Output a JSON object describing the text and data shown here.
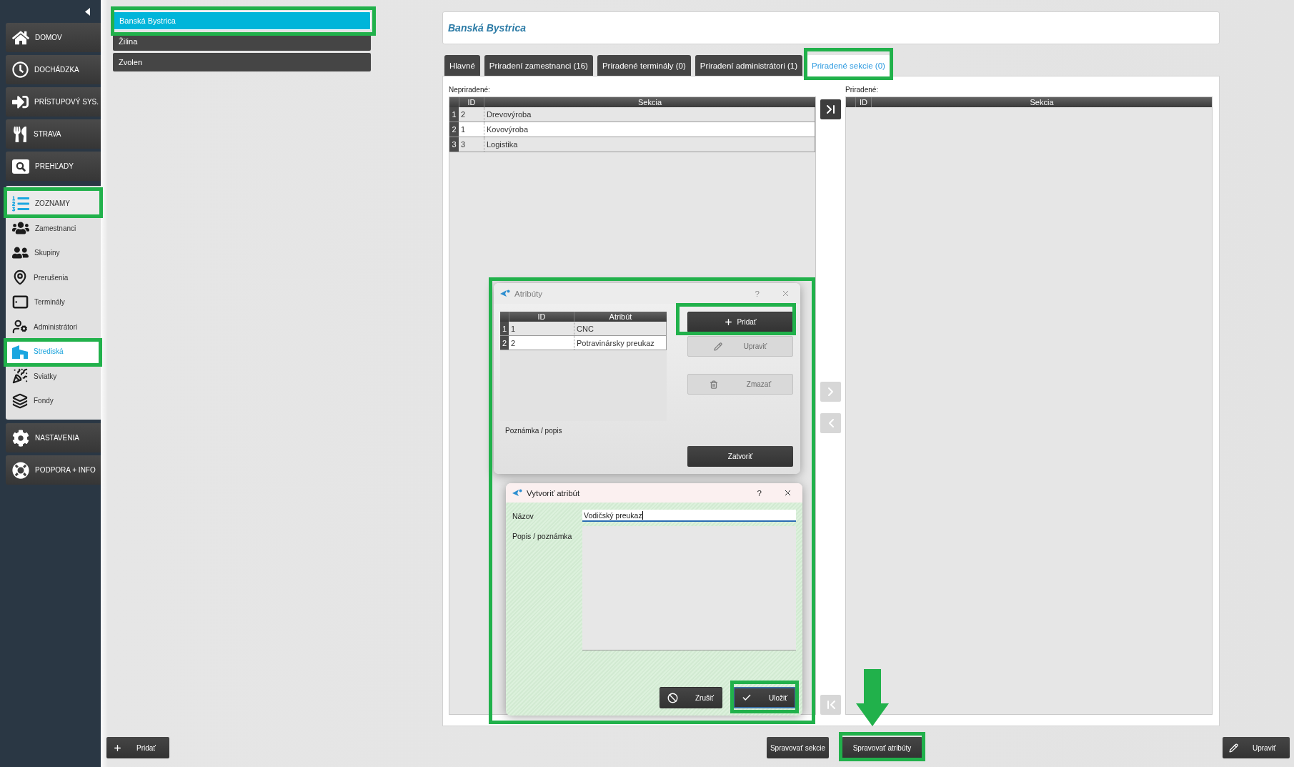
{
  "sidebar": {
    "items": [
      {
        "label": "DOMOV",
        "expanded": false,
        "highlighted": false
      },
      {
        "label": "DOCHÁDZKA",
        "expanded": false,
        "highlighted": false
      },
      {
        "label": "PRÍSTUPOVÝ SYS.",
        "expanded": false,
        "highlighted": false
      },
      {
        "label": "STRAVA",
        "expanded": false,
        "highlighted": false
      },
      {
        "label": "PREHĽADY",
        "expanded": false,
        "highlighted": false
      },
      {
        "label": "ZOZNAMY",
        "expanded": true,
        "highlighted": true,
        "children": [
          {
            "label": "Zamestnanci",
            "selected": false,
            "highlighted": false
          },
          {
            "label": "Skupiny",
            "selected": false,
            "highlighted": false
          },
          {
            "label": "Prerušenia",
            "selected": false,
            "highlighted": false
          },
          {
            "label": "Terminály",
            "selected": false,
            "highlighted": false
          },
          {
            "label": "Administrátori",
            "selected": false,
            "highlighted": false
          },
          {
            "label": "Strediská",
            "selected": true,
            "highlighted": true
          },
          {
            "label": "Sviatky",
            "selected": false,
            "highlighted": false
          },
          {
            "label": "Fondy",
            "selected": false,
            "highlighted": false
          }
        ]
      },
      {
        "label": "NASTAVENIA",
        "expanded": false,
        "highlighted": false
      },
      {
        "label": "PODPORA + INFO",
        "expanded": false,
        "highlighted": false
      }
    ]
  },
  "locations": [
    {
      "label": "Banská Bystrica",
      "selected": true,
      "highlighted": true
    },
    {
      "label": "Žilina",
      "selected": false,
      "highlighted": false
    },
    {
      "label": "Zvolen",
      "selected": false,
      "highlighted": false
    }
  ],
  "detail": {
    "title": "Banská Bystrica",
    "tabs": [
      {
        "label": "Hlavné",
        "selected": false,
        "highlighted": false
      },
      {
        "label": "Priradení zamestnanci (16)",
        "selected": false,
        "highlighted": false
      },
      {
        "label": "Priradené terminály (0)",
        "selected": false,
        "highlighted": false
      },
      {
        "label": "Priradení administrátori (1)",
        "selected": false,
        "highlighted": false
      },
      {
        "label": "Priradené sekcie (0)",
        "selected": true,
        "highlighted": true
      }
    ],
    "unassigned": {
      "label": "Nepriradené:",
      "columns": [
        "ID",
        "Sekcia"
      ],
      "rows": [
        {
          "number": "1",
          "cells": [
            "2",
            "Drevovýroba"
          ]
        },
        {
          "number": "2",
          "cells": [
            "1",
            "Kovovýroba"
          ]
        },
        {
          "number": "3",
          "cells": [
            "3",
            "Logistika"
          ]
        }
      ]
    },
    "transfer_buttons": [
      {
        "disabled": false
      },
      {
        "disabled": true
      },
      {
        "disabled": true
      },
      {
        "disabled": true
      }
    ],
    "assigned": {
      "label": "Priradené:",
      "columns": [
        "ID",
        "Sekcia"
      ]
    }
  },
  "dialogs": {
    "highlighted": true,
    "attributes_dialog": {
      "title": "Atribúty",
      "active": false,
      "help": "?",
      "columns": [
        "ID",
        "Atribút"
      ],
      "rows": [
        {
          "number": "1",
          "cells": [
            "1",
            "CNC"
          ]
        },
        {
          "number": "2",
          "cells": [
            "2",
            "Potravinársky preukaz"
          ]
        }
      ],
      "note_label": "Poznámka / popis",
      "buttons": [
        {
          "label": "Pridať",
          "disabled": false,
          "highlighted": true
        },
        {
          "label": "Upraviť",
          "disabled": true,
          "highlighted": false
        },
        {
          "label": "Zmazať",
          "disabled": true,
          "highlighted": false
        }
      ],
      "close_button": {
        "label": "Zatvoriť"
      }
    },
    "create_dialog": {
      "title": "Vytvoriť atribút",
      "active": true,
      "help": "?",
      "fields": [
        {
          "kind": "line",
          "label": "Názov",
          "value": "Vodičský preukaz",
          "focused": true
        },
        {
          "kind": "area",
          "label": "Popis / poznámka",
          "focused": false
        }
      ],
      "buttons": [
        {
          "label": "Zrušiť",
          "focused": false,
          "highlighted": false
        },
        {
          "label": "Uložiť",
          "focused": true,
          "highlighted": true
        }
      ]
    }
  },
  "bottom_bar": {
    "add_button": {
      "label": "Pridať"
    },
    "actions": [
      {
        "label": "Spravovať sekcie",
        "highlighted": false
      },
      {
        "label": "Spravovať atribúty",
        "highlighted": true
      }
    ],
    "pointer_arrow": true,
    "edit_button": {
      "label": "Upraviť"
    }
  }
}
